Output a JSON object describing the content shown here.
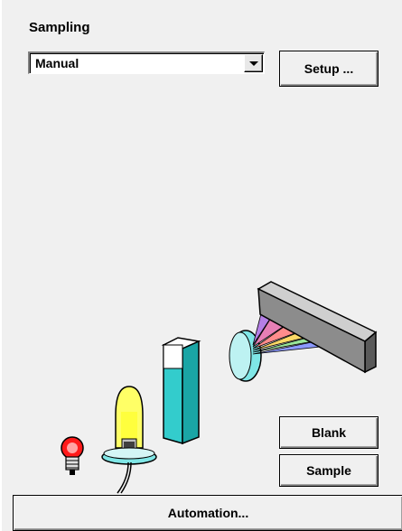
{
  "sampling": {
    "title": "Sampling",
    "mode_value": "Manual",
    "setup_label": "Setup ..."
  },
  "actions": {
    "blank_label": "Blank",
    "sample_label": "Sample",
    "automation_label": "Automation..."
  },
  "illustration": {
    "icons": [
      "red-bulb-icon",
      "lamp-icon",
      "cuvette-icon",
      "lens-icon",
      "grating-icon"
    ],
    "colors": {
      "bulb_red": "#ff1a1a",
      "lamp_yellow": "#ffff33",
      "cuvette_cyan": "#33cccc",
      "lens_cyan": "#7fe6e6",
      "grating_gray": "#8c8c8c"
    }
  }
}
